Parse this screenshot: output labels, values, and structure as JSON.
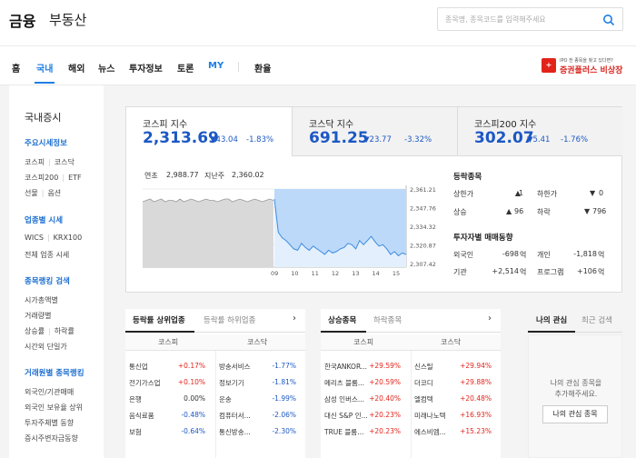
{
  "header": {
    "logo_main": "금융",
    "logo_sub": "부동산",
    "search_placeholder": "종목명, 종목코드를 입력해주세요"
  },
  "gnb": {
    "items": [
      "홈",
      "국내",
      "해외",
      "뉴스",
      "투자정보",
      "토론",
      "MY",
      "환율"
    ],
    "active": "국내"
  },
  "ad": {
    "line1": "IPO 전 종목을 찾고 있다면?",
    "line2": "증권플러스 비상장",
    "badge": "+"
  },
  "sidebar": {
    "title": "국내증시",
    "sections": [
      {
        "head": "주요시세정보",
        "items": [
          [
            "코스피",
            "코스닥"
          ],
          [
            "코스피200",
            "ETF"
          ],
          [
            "선물",
            "옵션"
          ]
        ]
      },
      {
        "head": "업종별 시세",
        "items": [
          [
            "WICS",
            "KRX100"
          ],
          [
            "전체 업종 시세"
          ]
        ]
      },
      {
        "head": "종목랭킹 검색",
        "items": [
          [
            "시가총액별"
          ],
          [
            "거래량별"
          ],
          [
            "상승률",
            "하락률"
          ],
          [
            "시간외 단일가"
          ]
        ]
      },
      {
        "head": "거래원별 종목랭킹",
        "items": [
          [
            "외국인/기관매매"
          ],
          [
            "외국인 보유율 상위"
          ],
          [
            "투자주체별 동향"
          ],
          [
            "증시주변자금동향"
          ]
        ]
      }
    ]
  },
  "indices": [
    {
      "name": "코스피 지수",
      "value": "2,313.69",
      "change": "▼43.04",
      "pct": "-1.83%"
    },
    {
      "name": "코스닥 지수",
      "value": "691.25",
      "change": "▼23.77",
      "pct": "-3.32%"
    },
    {
      "name": "코스피200 지수",
      "value": "302.07",
      "change": "▼5.41",
      "pct": "-1.76%"
    }
  ],
  "stats": {
    "high_label": "연초",
    "high_value": "2,988.77",
    "low_label": "지난주",
    "low_value": "2,360.02"
  },
  "chart_data": {
    "type": "area",
    "x_ticks": [
      "09",
      "10",
      "11",
      "12",
      "13",
      "14",
      "15"
    ],
    "y_ticks": [
      "2,361.21",
      "2,347.76",
      "2,334.32",
      "2,320.87",
      "2,307.42"
    ],
    "ylim": [
      2307.42,
      2361.21
    ],
    "series": [
      {
        "values": [
          2352,
          2353,
          2354,
          2352,
          2353,
          2354,
          2352,
          2353,
          2353,
          2352,
          2354,
          2352,
          2353,
          2354,
          2353,
          2352,
          2353,
          2354,
          2353,
          2353,
          2352,
          2353,
          2354,
          2354,
          2352,
          2353,
          2354,
          2353,
          2352,
          2353,
          2354,
          2353,
          2352,
          2353,
          2354,
          2353
        ]
      },
      {
        "values": [
          2354,
          2330,
          2326,
          2324,
          2321,
          2318,
          2317,
          2322,
          2319,
          2317,
          2320,
          2318,
          2316,
          2314,
          2317,
          2315,
          2316,
          2318,
          2319,
          2322,
          2321,
          2318,
          2324,
          2321,
          2324,
          2327,
          2323,
          2320,
          2321,
          2318,
          2314,
          2316,
          2313,
          2315,
          2314
        ]
      }
    ]
  },
  "rise_fall": {
    "title": "등락종목",
    "items": [
      {
        "label": "상한가",
        "value": "1",
        "dir": "up"
      },
      {
        "label": "하한가",
        "value": "0",
        "dir": "dn"
      },
      {
        "label": "상승",
        "value": "96",
        "dir": "up"
      },
      {
        "label": "하락",
        "value": "796",
        "dir": "dn"
      }
    ]
  },
  "trading": {
    "title": "투자자별 매매동향",
    "items": [
      {
        "label": "외국인",
        "value": "-698",
        "unit": "억",
        "dir": "dn"
      },
      {
        "label": "개인",
        "value": "-1,818",
        "unit": "억",
        "dir": "dn"
      },
      {
        "label": "기관",
        "value": "+2,514",
        "unit": "억",
        "dir": "up"
      },
      {
        "label": "프로그램",
        "value": "+106",
        "unit": "억",
        "dir": "up"
      }
    ]
  },
  "sector_panel": {
    "tab_on": "등락률 상위업종",
    "tab_off": "등락률 하위업종",
    "col1": "코스피",
    "col2": "코스닥",
    "left": [
      [
        "통신업",
        "+0.17%"
      ],
      [
        "전기가스업",
        "+0.10%"
      ],
      [
        "은행",
        "0.00%"
      ],
      [
        "음식료품",
        "-0.48%"
      ],
      [
        "보험",
        "-0.64%"
      ]
    ],
    "right": [
      [
        "방송서비스",
        "-1.77%"
      ],
      [
        "정보기기",
        "-1.81%"
      ],
      [
        "운송",
        "-1.99%"
      ],
      [
        "컴퓨터서...",
        "-2.06%"
      ],
      [
        "통신방송...",
        "-2.30%"
      ]
    ]
  },
  "stock_panel": {
    "tab_on": "상승종목",
    "tab_off": "하락종목",
    "col1": "코스피",
    "col2": "코스닥",
    "left": [
      [
        "한국ANKOR...",
        "+29.59%"
      ],
      [
        "메리츠 블룸...",
        "+20.59%"
      ],
      [
        "삼성 인버스...",
        "+20.40%"
      ],
      [
        "대신 S&P 인...",
        "+20.23%"
      ],
      [
        "TRUE 블룸...",
        "+20.23%"
      ]
    ],
    "right": [
      [
        "신스틸",
        "+29.94%"
      ],
      [
        "더코디",
        "+29.88%"
      ],
      [
        "엘컴텍",
        "+20.48%"
      ],
      [
        "미래나노텍",
        "+16.93%"
      ],
      [
        "에스비엠...",
        "+15.23%"
      ]
    ]
  },
  "my_panel": {
    "tab_on": "나의 관심",
    "tab_off": "최근 검색",
    "msg1": "나의 관심 종목을",
    "msg2": "추가해주세요.",
    "button": "나의 관심 종목"
  }
}
